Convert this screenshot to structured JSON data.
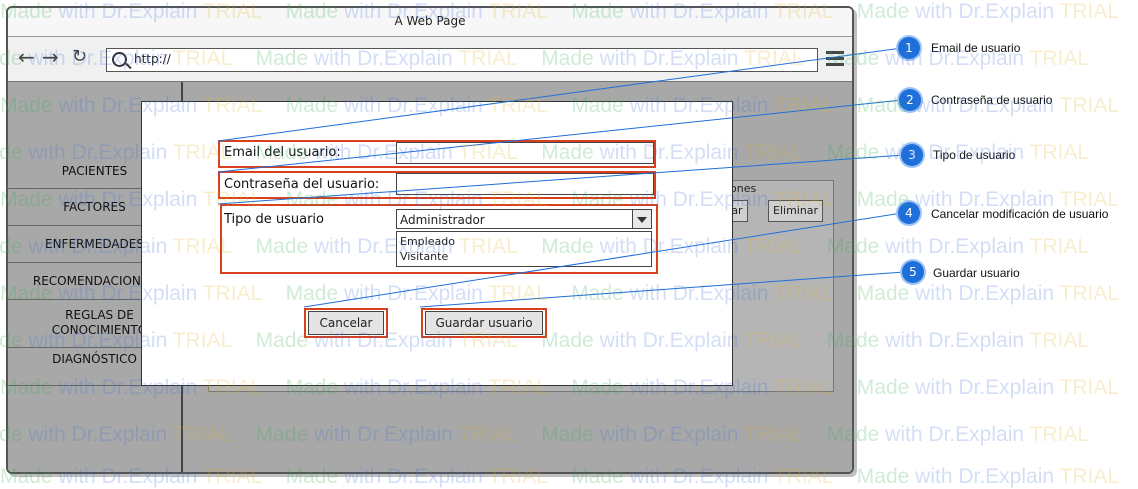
{
  "window": {
    "title": "A Web Page",
    "url": "http://"
  },
  "sidebar": {
    "items": [
      {
        "label": "PACIENTES"
      },
      {
        "label": "FACTORES"
      },
      {
        "label": "ENFERMEDADES"
      },
      {
        "label": "RECOMENDACIONES"
      },
      {
        "label": "REGLAS DE CONOCIMIENTO"
      },
      {
        "label": "DIAGNÓSTICO"
      }
    ]
  },
  "background": {
    "column_header": "ones",
    "edit_button": "tar",
    "delete_button": "Eliminar"
  },
  "form": {
    "email_label": "Email del usuario:",
    "email_value": "",
    "password_label": "Contraseña del usuario:",
    "password_value": "",
    "type_label": "Tipo de usuario",
    "type_selected": "Administrador",
    "type_options": [
      "Empleado",
      "Visitante"
    ],
    "cancel_button": "Cancelar",
    "save_button": "Guardar usuario"
  },
  "callouts": [
    {
      "number": "1",
      "text": "Email de usuario"
    },
    {
      "number": "2",
      "text": "Contraseña de usuario"
    },
    {
      "number": "3",
      "text": "Tipo de usuario"
    },
    {
      "number": "4",
      "text": "Cancelar modificación de usuario"
    },
    {
      "number": "5",
      "text": "Guardar usuario"
    }
  ],
  "watermark": "Made with Dr.Explain TRIAL"
}
